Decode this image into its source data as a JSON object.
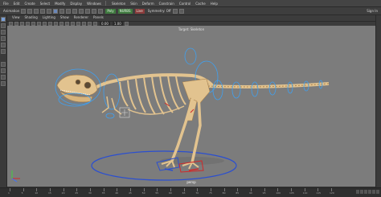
{
  "menubar": {
    "items": [
      "File",
      "Edit",
      "Create",
      "Select",
      "Modify",
      "Display",
      "Windows",
      "Skeleton",
      "Skin",
      "Deform",
      "Constrain",
      "Control",
      "Cache",
      "Help"
    ],
    "mode": "Animation"
  },
  "shelf": {
    "left_label": "Animation",
    "tags": [
      "Poly",
      "NURBS",
      "Live",
      "Symmetry: Off"
    ],
    "right_labels": [
      "Sign In"
    ]
  },
  "viewport": {
    "menus": [
      "View",
      "Shading",
      "Lighting",
      "Show",
      "Renderer",
      "Panels"
    ],
    "field_a": "0.00",
    "field_b": "1.00",
    "camera_label": "persp",
    "top_label": "Target: Skeleton"
  },
  "timeline": {
    "ticks": [
      "1",
      "5",
      "10",
      "15",
      "20",
      "25",
      "30",
      "35",
      "40",
      "45",
      "50",
      "55",
      "60",
      "65",
      "70",
      "75",
      "80",
      "85",
      "90",
      "95",
      "100",
      "105",
      "110",
      "115",
      "120"
    ]
  },
  "colors": {
    "bone": "#e2c38f",
    "bone_shade": "#a8824f",
    "control_blue": "#3fa0f0",
    "floor_circle": "#2b4fd0",
    "viewport_bg": "#7c7c7c",
    "accent_red": "#d02a2a"
  }
}
